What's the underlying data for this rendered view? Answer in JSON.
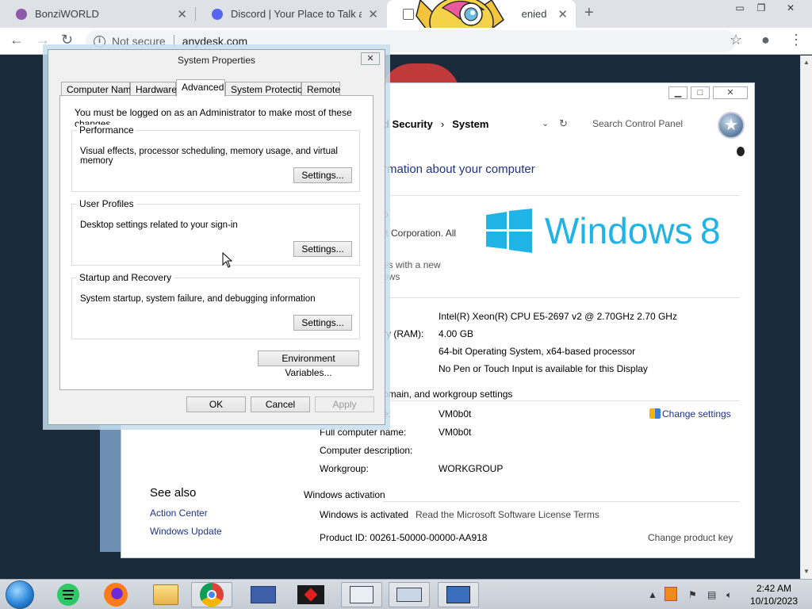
{
  "browser": {
    "tabs": [
      {
        "title": "BonziWORLD",
        "favicon_color": "#8e5aa8"
      },
      {
        "title": "Discord | Your Place to Talk and H",
        "favicon_color": "#5865f2"
      },
      {
        "title": "enied",
        "favicon_color": "#666666"
      }
    ],
    "tab_close": "✕",
    "new_tab": "+",
    "security_label": "Not secure",
    "url": "anydesk.com"
  },
  "control_panel": {
    "breadcrumb_partial": "d Security",
    "breadcrumb_current": "System",
    "search_placeholder": "Search Control Panel",
    "heading_partial": "rmation about your computer",
    "edition_lines": [
      "o",
      "ft Corporation. All"
    ],
    "upgrade_lines": [
      "es with a new",
      "ows"
    ],
    "logo_text": "Windows",
    "logo_version": "8",
    "system_rows": [
      {
        "label": "",
        "value": "Intel(R) Xeon(R) CPU E5-2697 v2 @ 2.70GHz   2.70 GHz"
      },
      {
        "label": "ry (RAM):",
        "value": "4.00 GB"
      },
      {
        "label": "",
        "value": "64-bit Operating System, x64-based processor"
      },
      {
        "label": "",
        "value": "No Pen or Touch Input is available for this Display"
      }
    ],
    "domain_section_partial": "omain, and workgroup settings",
    "computer_rows": [
      {
        "label": "e:",
        "value": "VM0b0t"
      },
      {
        "label": "Full computer name:",
        "value": "VM0b0t"
      },
      {
        "label": "Computer description:",
        "value": ""
      },
      {
        "label": "Workgroup:",
        "value": "WORKGROUP"
      }
    ],
    "change_settings": "Change settings",
    "activation_section": "Windows activation",
    "activation_status": "Windows is activated",
    "license_link": "Read the Microsoft Software License Terms",
    "product_id": "Product ID:  00261-50000-00000-AA918",
    "change_product_key": "Change product key",
    "see_also_title": "See also",
    "see_also_links": [
      "Action Center",
      "Windows Update"
    ]
  },
  "dialog": {
    "title": "System Properties",
    "tabs": [
      "Computer Name",
      "Hardware",
      "Advanced",
      "System Protection",
      "Remote"
    ],
    "active_tab": "Advanced",
    "admin_note": "You must be logged on as an Administrator to make most of these changes.",
    "groups": [
      {
        "title": "Performance",
        "desc": "Visual effects, processor scheduling, memory usage, and virtual memory",
        "button": "Settings..."
      },
      {
        "title": "User Profiles",
        "desc": "Desktop settings related to your sign-in",
        "button": "Settings..."
      },
      {
        "title": "Startup and Recovery",
        "desc": "System startup, system failure, and debugging information",
        "button": "Settings..."
      }
    ],
    "env_button": "Environment Variables...",
    "ok": "OK",
    "cancel": "Cancel",
    "apply": "Apply"
  },
  "taskbar": {
    "time": "2:42 AM",
    "date": "10/10/2023"
  }
}
